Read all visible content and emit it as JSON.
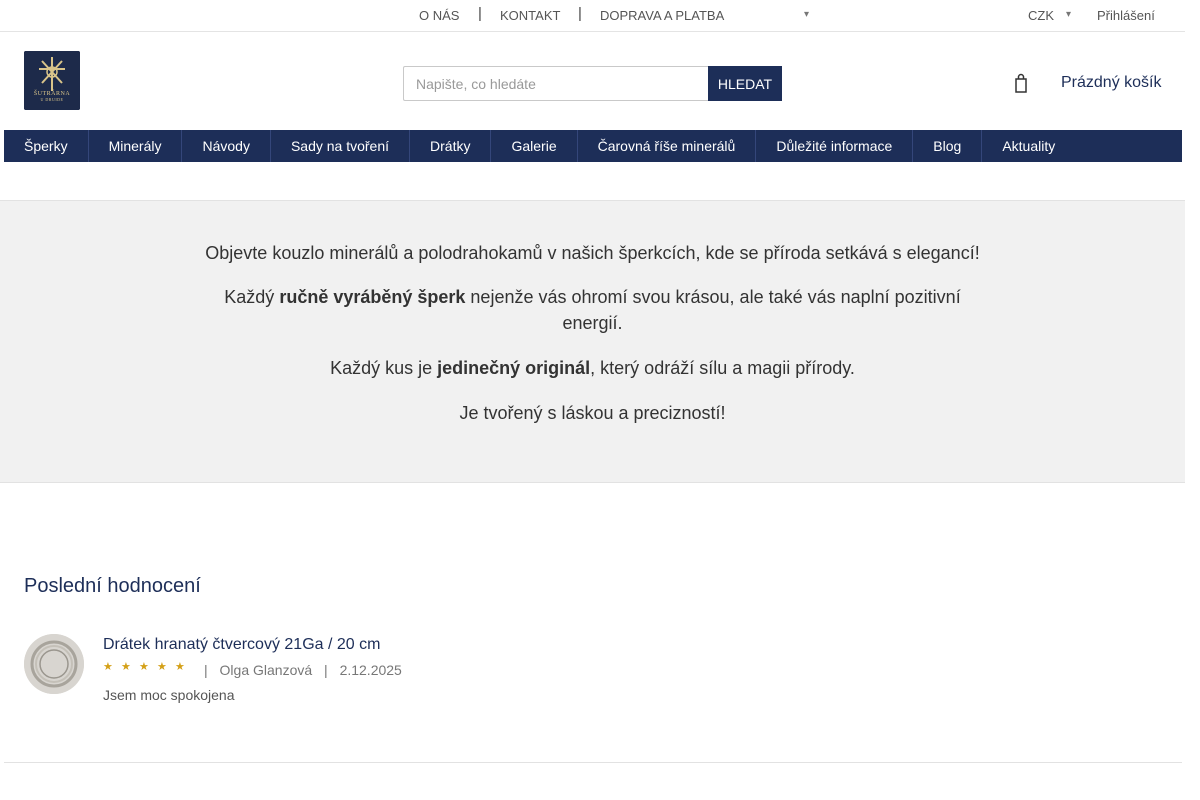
{
  "topbar": {
    "links": [
      "O NÁS",
      "KONTAKT",
      "DOPRAVA A PLATBA"
    ],
    "separator": "|",
    "currency": "CZK",
    "login": "Přihlášení"
  },
  "header": {
    "logo_text": "ŠUTRÁRNA",
    "logo_subtext": "U DRUIDE",
    "search": {
      "placeholder": "Napište, co hledáte",
      "button": "HLEDAT"
    },
    "cart": {
      "label": "Prázdný košík"
    }
  },
  "nav": {
    "items": [
      "Šperky",
      "Minerály",
      "Návody",
      "Sady na tvoření",
      "Drátky",
      "Galerie",
      "Čarovná říše minerálů",
      "Důležité informace",
      "Blog",
      "Aktuality"
    ]
  },
  "intro": {
    "p1": "Objevte kouzlo minerálů a polodrahokamů v našich šperkcích, kde se příroda setkává s elegancí!",
    "p2_before": "Každý ",
    "p2_bold": "ručně vyráběný šperk",
    "p2_after": " nejenže vás ohromí svou krásou, ale také vás naplní pozitivní energií.",
    "p3_before": "Každý kus je ",
    "p3_bold": "jedinečný originál",
    "p3_after": ", který odráží sílu a magii přírody.",
    "p4": "Je tvořený s láskou a precizností!"
  },
  "reviews": {
    "title": "Poslední hodnocení",
    "items": [
      {
        "product": "Drátek hranatý čtvercový 21Ga / 20 cm",
        "rating": 5,
        "separator": "|",
        "author": "Olga Glanzová",
        "date": "2.12.2025",
        "text": "Jsem moc spokojena"
      }
    ]
  },
  "colors": {
    "brand": "#1d2e58",
    "band": "#f1f1f1",
    "star": "#d4a017"
  },
  "icons": {
    "search_toggle": "chevron-down-icon",
    "currency_toggle": "chevron-down-icon",
    "cart": "cart-icon",
    "star": "star-icon"
  }
}
